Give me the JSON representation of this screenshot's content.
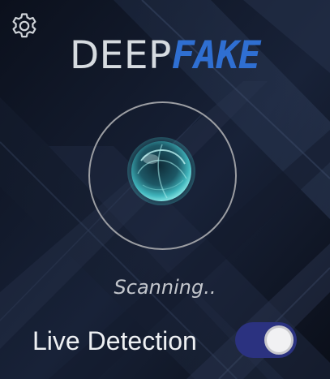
{
  "header": {
    "logo_part1": "DEEP",
    "logo_part2": "FAKE",
    "settings_icon": "gear-icon"
  },
  "scanner": {
    "status_text": "Scanning..",
    "orb_icon": "scan-orb-icon"
  },
  "live_detection": {
    "label": "Live Detection",
    "enabled": true
  },
  "colors": {
    "background": "#0d1220",
    "logo_primary": "#d6dbe0",
    "logo_accent": "#2f6fd2",
    "ring": "#9c9ea3",
    "toggle_on": "#2b3280",
    "orb": "#3fb4bb"
  }
}
